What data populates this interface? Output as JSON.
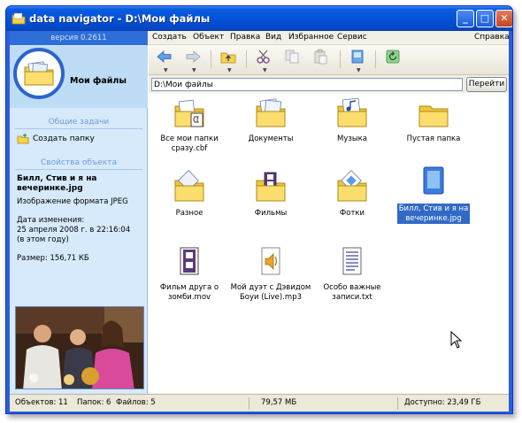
{
  "window": {
    "title": "data navigator - D:\\Мои файлы",
    "version": "версия 0.2611"
  },
  "left_panel": {
    "folder_name": "Мои файлы",
    "tasks_title": "Общие задачи",
    "create_folder": "Создать папку",
    "props_title": "Свойства объекта",
    "object_name_line1": "Билл, Стив и я на",
    "object_name_line2": "вечеринке.jpg",
    "object_type": "Изображение формата JPEG",
    "modified_label": "Дата изменения:",
    "modified_value": "25 апреля 2008 г. в 22:16:04",
    "modified_note": "(в этом году)",
    "size": "Размер: 156,71 КБ"
  },
  "menu": {
    "items": [
      "Создать",
      "Объект",
      "Правка",
      "Вид",
      "Избранное",
      "Сервис"
    ],
    "help": "Справка"
  },
  "address": {
    "value": "D:\\Мои файлы",
    "go_label": "Перейти"
  },
  "files": [
    {
      "label": "Все мои папки\nсразу.cbf",
      "icon": "folder-archive-icon"
    },
    {
      "label": "Документы",
      "icon": "folder-documents-icon"
    },
    {
      "label": "Музыка",
      "icon": "folder-music-icon"
    },
    {
      "label": "Пустая папка",
      "icon": "folder-empty-icon"
    },
    {
      "label": "Разное",
      "icon": "folder-misc-icon"
    },
    {
      "label": "Фильмы",
      "icon": "folder-films-icon"
    },
    {
      "label": "Фотки",
      "icon": "folder-photos-icon"
    },
    {
      "label": "Билл, Стив и я на\nвечеринке.jpg",
      "icon": "image-file-icon",
      "selected": true
    },
    {
      "label": "Фильм друга о\nзомби.mov",
      "icon": "video-file-icon"
    },
    {
      "label": "Мой дуэт с Дэвидом\nБоуи (Live).mp3",
      "icon": "audio-file-icon"
    },
    {
      "label": "Особо важные\nзаписи.txt",
      "icon": "text-file-icon"
    }
  ],
  "status": {
    "objects": "Объектов: 11",
    "folders": "Папок: 6",
    "files": "Файлов: 5",
    "size": "79,57 МБ",
    "free": "Доступно: 23,49 ГБ"
  },
  "colors": {
    "title_bar": "#0453d8",
    "left_panel": "#d6eafb",
    "selection": "#316ac5",
    "folder": "#f7d24d"
  }
}
